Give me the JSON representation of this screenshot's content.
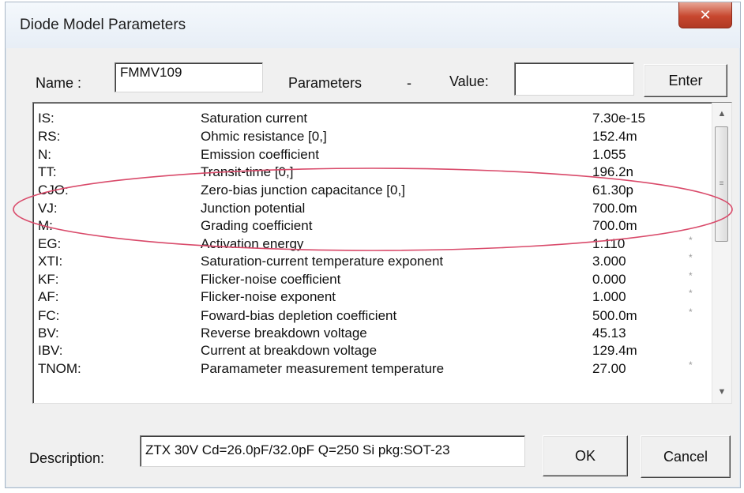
{
  "window": {
    "title": "Diode Model Parameters",
    "close_glyph": "✕"
  },
  "header": {
    "name_label": "Name :",
    "name_value": "FMMV109",
    "parameters_label": "Parameters",
    "separator": "-",
    "value_label": "Value:",
    "value_input": "",
    "enter_label": "Enter"
  },
  "parameters": [
    {
      "name": "IS:",
      "desc": "Saturation current",
      "value": "7.30e-15",
      "flag": ""
    },
    {
      "name": "RS:",
      "desc": "Ohmic resistance [0,]",
      "value": "152.4m",
      "flag": ""
    },
    {
      "name": "N:",
      "desc": "Emission coefficient",
      "value": "1.055",
      "flag": ""
    },
    {
      "name": "TT:",
      "desc": "Transit-time [0,]",
      "value": "196.2n",
      "flag": ""
    },
    {
      "name": "CJO:",
      "desc": "Zero-bias junction capacitance [0,]",
      "value": "61.30p",
      "flag": ""
    },
    {
      "name": "VJ:",
      "desc": "Junction potential",
      "value": "700.0m",
      "flag": ""
    },
    {
      "name": "M:",
      "desc": "Grading coefficient",
      "value": "700.0m",
      "flag": ""
    },
    {
      "name": "EG:",
      "desc": "Activation energy",
      "value": "1.110",
      "flag": "*"
    },
    {
      "name": "XTI:",
      "desc": "Saturation-current temperature exponent",
      "value": "3.000",
      "flag": "*"
    },
    {
      "name": "KF:",
      "desc": "Flicker-noise coefficient",
      "value": "0.000",
      "flag": "*"
    },
    {
      "name": "AF:",
      "desc": "Flicker-noise exponent",
      "value": "1.000",
      "flag": "*"
    },
    {
      "name": "FC:",
      "desc": "Foward-bias depletion coefficient",
      "value": "500.0m",
      "flag": "*"
    },
    {
      "name": "BV:",
      "desc": "Reverse breakdown voltage",
      "value": "45.13",
      "flag": ""
    },
    {
      "name": "IBV:",
      "desc": "Current at breakdown voltage",
      "value": "129.4m",
      "flag": ""
    },
    {
      "name": "TNOM:",
      "desc": "Paramameter measurement temperature",
      "value": "27.00",
      "flag": "*"
    }
  ],
  "footer": {
    "description_label": "Description:",
    "description_value": "ZTX 30V Cd=26.0pF/32.0pF Q=250 Si pkg:SOT-23",
    "ok_label": "OK",
    "cancel_label": "Cancel"
  },
  "colors": {
    "highlight_ellipse": "#d94a6a"
  }
}
